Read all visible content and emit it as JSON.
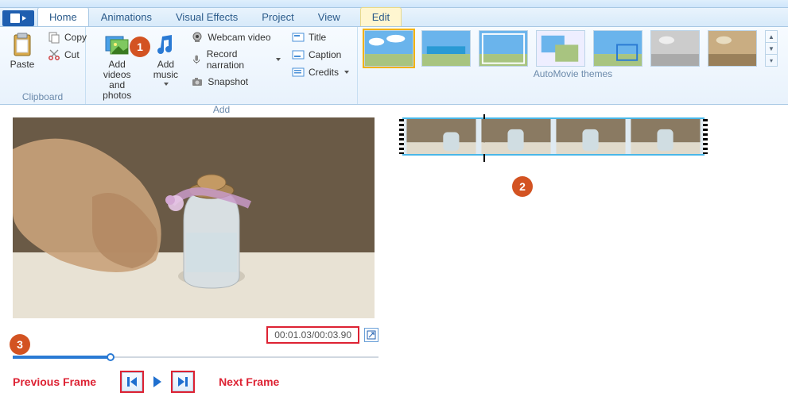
{
  "tabs": {
    "home": "Home",
    "animations": "Animations",
    "visual_effects": "Visual Effects",
    "project": "Project",
    "view": "View",
    "context_edit": "Edit"
  },
  "ribbon": {
    "clipboard": {
      "paste": "Paste",
      "copy": "Copy",
      "cut": "Cut",
      "label": "Clipboard"
    },
    "add": {
      "add_videos_photos": "Add videos\nand photos",
      "add_music": "Add\nmusic",
      "webcam_video": "Webcam video",
      "record_narration": "Record narration",
      "snapshot": "Snapshot",
      "title": "Title",
      "caption": "Caption",
      "credits": "Credits",
      "label": "Add"
    },
    "themes": {
      "label": "AutoMovie themes"
    }
  },
  "preview": {
    "time": "00:01.03/00:03.90"
  },
  "annotations": {
    "prev_frame": "Previous Frame",
    "next_frame": "Next Frame",
    "c1": "1",
    "c2": "2",
    "c3": "3"
  }
}
